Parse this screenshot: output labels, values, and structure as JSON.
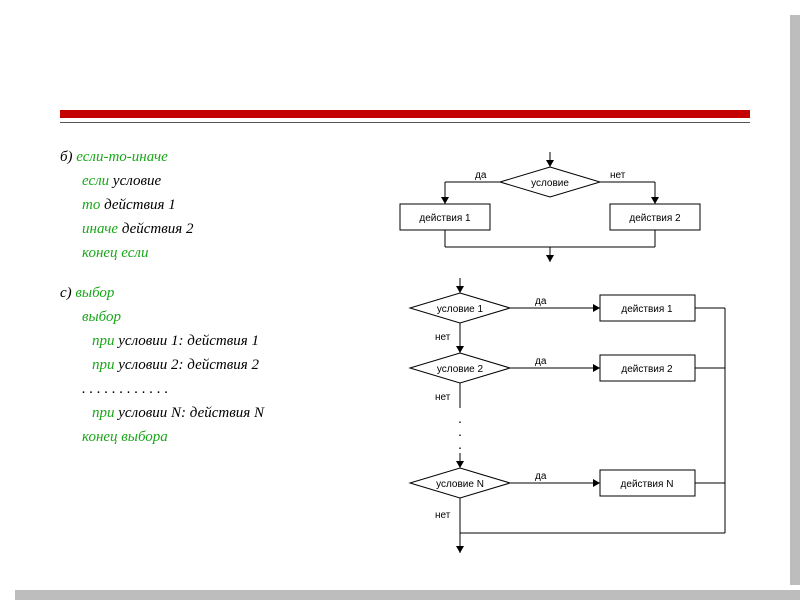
{
  "section_b": {
    "heading_prefix": "б) ",
    "heading": "если-то-иначе",
    "line1_kw": "если",
    "line1_txt": " условие",
    "line2_kw": "то",
    "line2_txt": " действия 1",
    "line3_kw": "иначе",
    "line3_txt": " действия 2",
    "line4": "конец если"
  },
  "section_c": {
    "heading_prefix": "с) ",
    "heading": "выбор",
    "line1": "выбор",
    "line2_kw": "при",
    "line2_txt": " условии 1: действия 1",
    "line3_kw": "при",
    "line3_txt": " условии 2: действия 2",
    "dots": " . . . . . . . . . . . .",
    "line4_kw": "при",
    "line4_txt": " условии N: действия N",
    "line5": "конец выбора"
  },
  "diag_b": {
    "cond": "условие",
    "yes": "да",
    "no": "нет",
    "act1": "действия 1",
    "act2": "действия 2"
  },
  "diag_c": {
    "cond1": "условие 1",
    "cond2": "условие 2",
    "condN": "условие N",
    "yes": "да",
    "no": "нет",
    "act1": "действия 1",
    "act2": "действия 2",
    "actN": "действия N"
  }
}
